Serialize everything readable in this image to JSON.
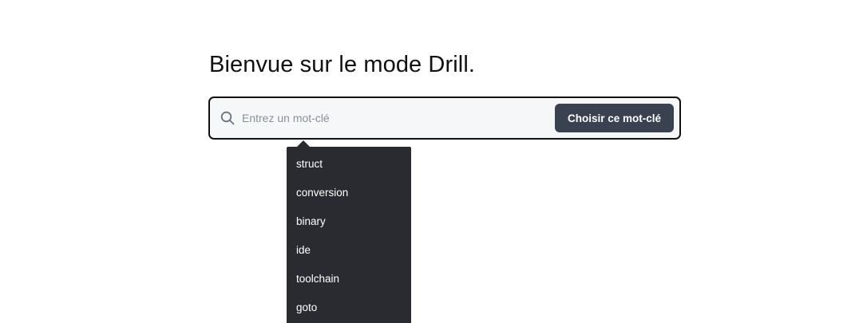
{
  "page": {
    "title": "Bienvue sur le mode Drill."
  },
  "search": {
    "icon": "search-icon",
    "placeholder": "Entrez un mot-clé",
    "value": "",
    "button_label": "Choisir ce mot-clé"
  },
  "colors": {
    "button_bg": "#3a4252",
    "dropdown_bg": "#2a2b30",
    "input_bg": "#f6f7f9",
    "border": "#111111"
  },
  "suggestions": {
    "items": [
      {
        "label": "struct"
      },
      {
        "label": "conversion"
      },
      {
        "label": "binary"
      },
      {
        "label": "ide"
      },
      {
        "label": "toolchain"
      },
      {
        "label": "goto"
      }
    ]
  }
}
